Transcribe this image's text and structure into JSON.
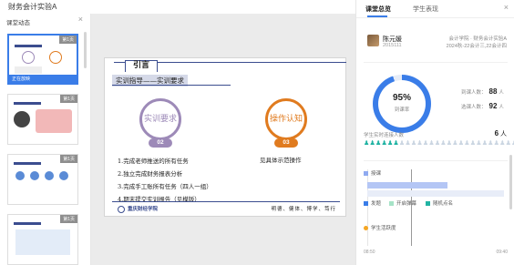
{
  "app": {
    "title": "财务会计实验A"
  },
  "left_panel": {
    "header": "课堂动态",
    "close_icon": "close-icon",
    "thumbnails": [
      {
        "tag": "第1页",
        "status": "正在放映",
        "active": true
      },
      {
        "tag": "第1页",
        "status": "",
        "active": false
      },
      {
        "tag": "第1页",
        "status": "",
        "active": false
      },
      {
        "tag": "第1页",
        "status": "",
        "active": false
      }
    ]
  },
  "slide": {
    "tab_title": "引言",
    "subtitle": "实训指导——实训要求",
    "circle_left": {
      "text": "实训要求",
      "pill": "02",
      "color": "#9d8ab8"
    },
    "circle_right": {
      "text": "操作认知",
      "pill": "03",
      "color": "#e07b1f"
    },
    "bullets": [
      "1.完成老师推送的所有任务",
      "2.独立完成财务报表分析",
      "3.完成手工账所有任务（四人一组）",
      "4.期末提交实训报告（见模版）"
    ],
    "right_note": "见具体示范操作",
    "school_name": "重庆财经学院",
    "motto": "明德、健体、博学、笃行"
  },
  "right_panel": {
    "tabs": [
      "课堂总览",
      "学生表现"
    ],
    "active_tab": 0,
    "teacher": {
      "name": "陈元媛",
      "id": "2015111",
      "info1": "会计学院 · 财务会计实验A",
      "info2": "2024秋-22会计三,22会计四"
    },
    "attendance": {
      "percent": "95%",
      "label": "到课率",
      "percent_value": 0.95,
      "arrived_label": "到课人数：",
      "arrived": "88",
      "selected_label": "选课人数：",
      "selected": "92",
      "unit": "人",
      "accent": "#3a7de8"
    },
    "live": {
      "label": "学生实时连接人数",
      "count": "6",
      "unit": "人",
      "online_icon_color": "#21b3a3",
      "offline_icon_color": "#cbd6e2"
    },
    "timeline": {
      "legend_teaching": "授课",
      "legend_post": "发题",
      "legend_danmu": "开启弹幕",
      "legend_random": "随机点名",
      "legend_activity": "学生活跃度",
      "start_time": "08:50",
      "end_time": "09:40"
    }
  }
}
